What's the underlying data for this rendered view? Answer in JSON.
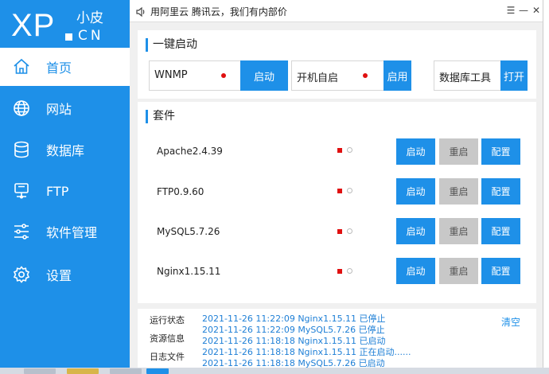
{
  "logo": {
    "text_xp": "XP",
    "text_cn_top": "小皮",
    "text_cn_bottom": "CN"
  },
  "sidebar": {
    "items": [
      {
        "label": "首页",
        "icon": "home-icon",
        "active": true
      },
      {
        "label": "网站",
        "icon": "globe-icon"
      },
      {
        "label": "数据库",
        "icon": "database-icon"
      },
      {
        "label": "FTP",
        "icon": "ftp-icon"
      },
      {
        "label": "软件管理",
        "icon": "sliders-icon"
      },
      {
        "label": "设置",
        "icon": "gear-icon"
      }
    ]
  },
  "titlebar": {
    "text": "用阿里云 腾讯云，我们有内部价",
    "icon": "speaker-icon",
    "menu_glyph": "☰",
    "min_glyph": "—",
    "close_glyph": "✕"
  },
  "quick_start": {
    "title": "一键启动",
    "items": [
      {
        "label": "WNMP",
        "button": "启动",
        "dot": true
      },
      {
        "label": "开机自启",
        "button": "启用",
        "dot": true
      },
      {
        "label": "数据库工具",
        "button": "打开",
        "dot": false
      }
    ]
  },
  "suite": {
    "title": "套件",
    "services": [
      {
        "name": "Apache2.4.39",
        "start": "启动",
        "restart": "重启",
        "config": "配置"
      },
      {
        "name": "FTP0.9.60",
        "start": "启动",
        "restart": "重启",
        "config": "配置"
      },
      {
        "name": "MySQL5.7.26",
        "start": "启动",
        "restart": "重启",
        "config": "配置"
      },
      {
        "name": "Nginx1.15.11",
        "start": "启动",
        "restart": "重启",
        "config": "配置"
      }
    ]
  },
  "log": {
    "tabs": [
      "运行状态",
      "资源信息",
      "日志文件"
    ],
    "clear": "清空",
    "lines": [
      "2021-11-26 11:22:09 Nginx1.15.11 已停止",
      "2021-11-26 11:22:09 MySQL5.7.26 已停止",
      "2021-11-26 11:18:18 Nginx1.15.11 已启动",
      "2021-11-26 11:18:18 Nginx1.15.11 正在启动......",
      "2021-11-26 11:18:18 MySQL5.7.26 已启动"
    ]
  },
  "colors": {
    "accent": "#1e90e8",
    "status_stopped": "#e01010",
    "button_disabled": "#c8c8c8"
  }
}
